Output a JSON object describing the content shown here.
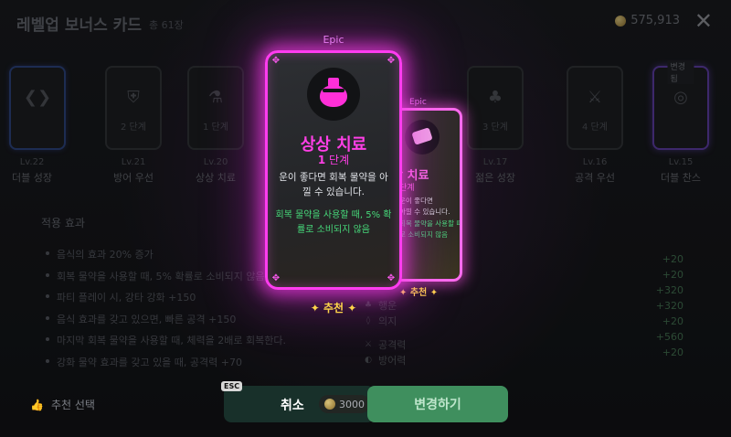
{
  "header": {
    "title": "레벨업 보너스 카드",
    "count": "총 61장",
    "currency": "575,913",
    "close_symbol": "✕"
  },
  "background_cards": [
    {
      "level": "Lv.22",
      "name": "더블 성장",
      "stage": "",
      "icon": "chevron-icon"
    },
    {
      "level": "Lv.21",
      "name": "방어 우선",
      "stage": "2 단계",
      "icon": "shield-icon"
    },
    {
      "level": "Lv.20",
      "name": "상상 치료",
      "stage": "1 단계",
      "icon": "flask-icon"
    },
    {
      "level": "Lv.17",
      "name": "젊은 성장",
      "stage": "3 단계",
      "icon": "clover-icon"
    },
    {
      "level": "Lv.16",
      "name": "공격 우선",
      "stage": "4 단계",
      "icon": "sword-icon"
    },
    {
      "level": "Lv.15",
      "name": "더블 찬스",
      "stage": "",
      "icon": "target-icon",
      "tag": "변경됨"
    }
  ],
  "effects": {
    "title": "적용 효과",
    "items": [
      "음식의 효과 20% 증가",
      "회복 물약을 사용할 때, 5% 확률로 소비되지 않음",
      "파티 플레이 시, 강타 강화 +150",
      "음식 효과를 갖고 있으면, 빠른 공격 +150",
      "마지막 회복 물약을 사용할 때, 체력을 2배로 회복한다.",
      "강화 물약 효과를 갖고 있을 때, 공격력 +70"
    ]
  },
  "stats": [
    {
      "icon": "♣",
      "label": "행운"
    },
    {
      "icon": "◊",
      "label": "의지"
    },
    {
      "icon": "⚔",
      "label": "공격력"
    },
    {
      "icon": "◐",
      "label": "방어력"
    }
  ],
  "stat_plus": [
    "+20",
    "+20",
    "+320",
    "+320",
    "+20",
    "+560",
    "+20"
  ],
  "main_card": {
    "rarity": "Epic",
    "name": "상상 치료",
    "stage_num": "1",
    "stage_word": "단계",
    "desc": "운이 좋다면 회복 물약을 아낄 수 있습니다.",
    "effect": "회복 물약을 사용할 때, 5% 확률로 소비되지 않음",
    "recommend": "✦ 추천 ✦"
  },
  "second_card": {
    "rarity": "Epic",
    "name": "상 치료",
    "stage": "단계",
    "desc_line1": "운이 좋다면",
    "desc_line2": "아낄 수 있습니다.",
    "effect_line1": "회복 물약을 사용할 때,",
    "effect_line2": "로 소비되지 않음",
    "recommend": "✦ 추천 ✦"
  },
  "bottom": {
    "recommend_select": "추천 선택",
    "esc": "ESC",
    "cancel": "취소",
    "cost": "3000",
    "change": "변경하기"
  },
  "colors": {
    "epic_glow": "#ff3cf0",
    "effect_green": "#47d97a",
    "recommend_gold": "#ffd54a",
    "change_button": "#3f8f5e"
  }
}
